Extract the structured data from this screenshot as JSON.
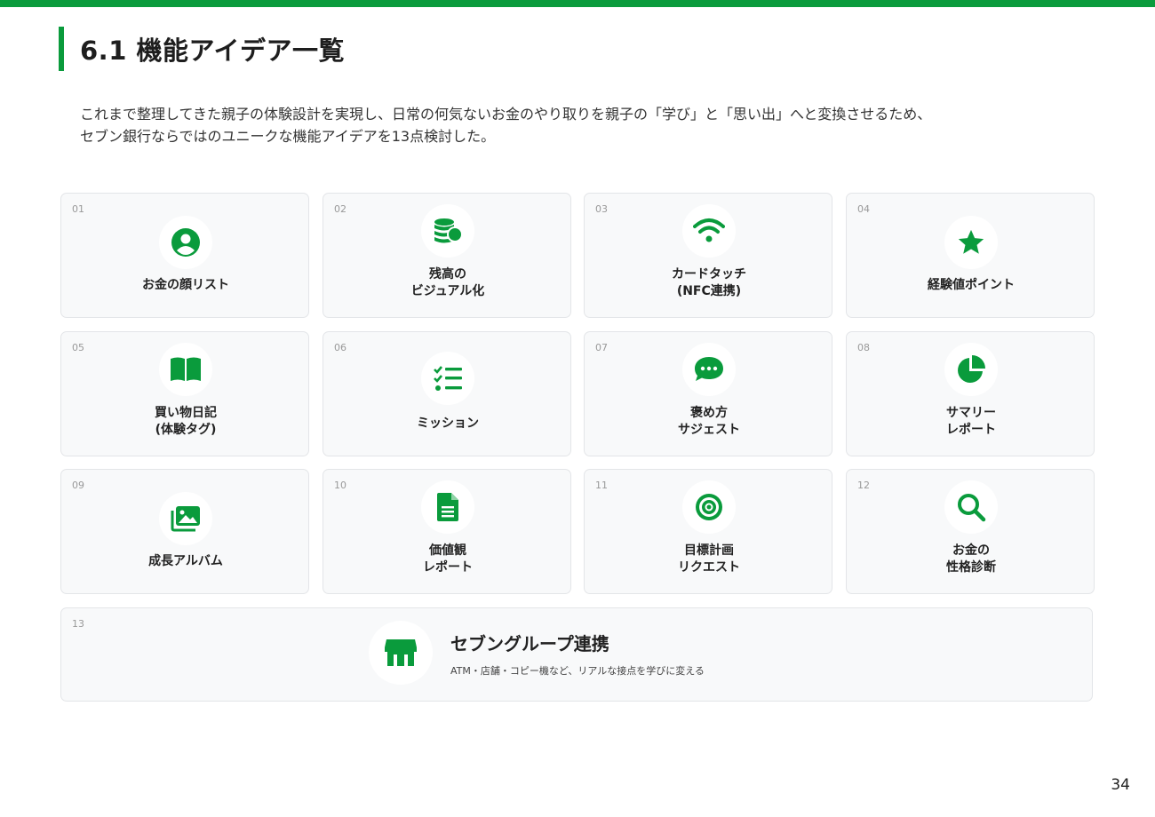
{
  "header": {
    "title": "6.1 機能アイデア一覧"
  },
  "intro": {
    "line1": "これまで整理してきた親子の体験設計を実現し、日常の何気ないお金のやり取りを親子の「学び」と「思い出」へと変換させるため、",
    "line2": "セブン銀行ならではのユニークな機能アイデアを13点検討した。"
  },
  "colors": {
    "accent": "#0a9b3c",
    "card_bg": "#f8f9fa"
  },
  "features": [
    {
      "num": "01",
      "line1": "お金の顔リスト",
      "line2": "",
      "icon": "user-circle-icon"
    },
    {
      "num": "02",
      "line1": "残高の",
      "line2": "ビジュアル化",
      "icon": "coins-icon"
    },
    {
      "num": "03",
      "line1": "カードタッチ",
      "line2": "(NFC連携)",
      "icon": "wifi-icon"
    },
    {
      "num": "04",
      "line1": "経験値ポイント",
      "line2": "",
      "icon": "star-icon"
    },
    {
      "num": "05",
      "line1": "買い物日記",
      "line2": "(体験タグ)",
      "icon": "book-icon"
    },
    {
      "num": "06",
      "line1": "ミッション",
      "line2": "",
      "icon": "checklist-icon"
    },
    {
      "num": "07",
      "line1": "褒め方",
      "line2": "サジェスト",
      "icon": "chat-bubble-icon"
    },
    {
      "num": "08",
      "line1": "サマリー",
      "line2": "レポート",
      "icon": "pie-chart-icon"
    },
    {
      "num": "09",
      "line1": "成長アルバム",
      "line2": "",
      "icon": "photo-album-icon"
    },
    {
      "num": "10",
      "line1": "価値観",
      "line2": "レポート",
      "icon": "document-icon"
    },
    {
      "num": "11",
      "line1": "目標計画",
      "line2": "リクエスト",
      "icon": "target-icon"
    },
    {
      "num": "12",
      "line1": "お金の",
      "line2": "性格診断",
      "icon": "search-icon"
    }
  ],
  "wide_feature": {
    "num": "13",
    "title": "セブングループ連携",
    "subtitle": "ATM・店舗・コピー機など、リアルな接点を学びに変える",
    "icon": "store-icon"
  },
  "page_number": "34"
}
